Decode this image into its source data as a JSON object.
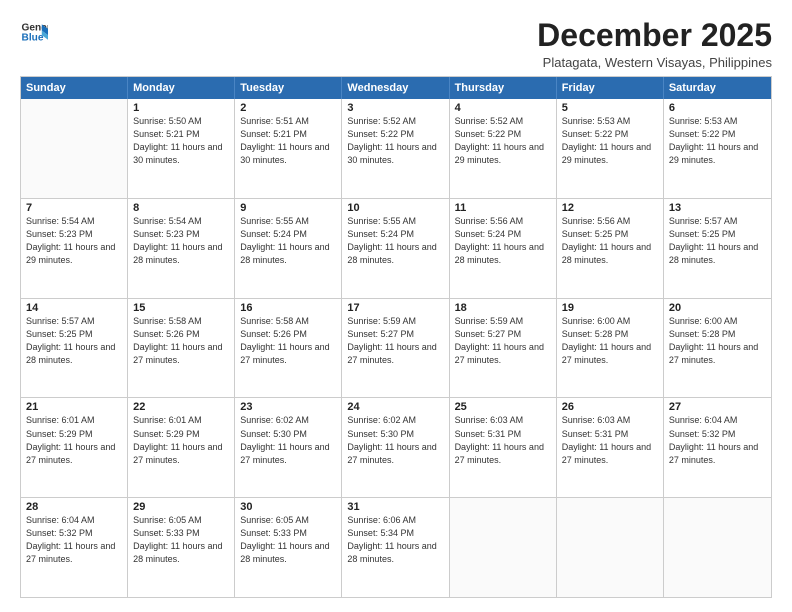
{
  "logo": {
    "line1": "General",
    "line2": "Blue"
  },
  "title": "December 2025",
  "subtitle": "Platagata, Western Visayas, Philippines",
  "header_days": [
    "Sunday",
    "Monday",
    "Tuesday",
    "Wednesday",
    "Thursday",
    "Friday",
    "Saturday"
  ],
  "weeks": [
    [
      {
        "day": "",
        "sunrise": "",
        "sunset": "",
        "daylight": ""
      },
      {
        "day": "1",
        "sunrise": "Sunrise: 5:50 AM",
        "sunset": "Sunset: 5:21 PM",
        "daylight": "Daylight: 11 hours and 30 minutes."
      },
      {
        "day": "2",
        "sunrise": "Sunrise: 5:51 AM",
        "sunset": "Sunset: 5:21 PM",
        "daylight": "Daylight: 11 hours and 30 minutes."
      },
      {
        "day": "3",
        "sunrise": "Sunrise: 5:52 AM",
        "sunset": "Sunset: 5:22 PM",
        "daylight": "Daylight: 11 hours and 30 minutes."
      },
      {
        "day": "4",
        "sunrise": "Sunrise: 5:52 AM",
        "sunset": "Sunset: 5:22 PM",
        "daylight": "Daylight: 11 hours and 29 minutes."
      },
      {
        "day": "5",
        "sunrise": "Sunrise: 5:53 AM",
        "sunset": "Sunset: 5:22 PM",
        "daylight": "Daylight: 11 hours and 29 minutes."
      },
      {
        "day": "6",
        "sunrise": "Sunrise: 5:53 AM",
        "sunset": "Sunset: 5:22 PM",
        "daylight": "Daylight: 11 hours and 29 minutes."
      }
    ],
    [
      {
        "day": "7",
        "sunrise": "Sunrise: 5:54 AM",
        "sunset": "Sunset: 5:23 PM",
        "daylight": "Daylight: 11 hours and 29 minutes."
      },
      {
        "day": "8",
        "sunrise": "Sunrise: 5:54 AM",
        "sunset": "Sunset: 5:23 PM",
        "daylight": "Daylight: 11 hours and 28 minutes."
      },
      {
        "day": "9",
        "sunrise": "Sunrise: 5:55 AM",
        "sunset": "Sunset: 5:24 PM",
        "daylight": "Daylight: 11 hours and 28 minutes."
      },
      {
        "day": "10",
        "sunrise": "Sunrise: 5:55 AM",
        "sunset": "Sunset: 5:24 PM",
        "daylight": "Daylight: 11 hours and 28 minutes."
      },
      {
        "day": "11",
        "sunrise": "Sunrise: 5:56 AM",
        "sunset": "Sunset: 5:24 PM",
        "daylight": "Daylight: 11 hours and 28 minutes."
      },
      {
        "day": "12",
        "sunrise": "Sunrise: 5:56 AM",
        "sunset": "Sunset: 5:25 PM",
        "daylight": "Daylight: 11 hours and 28 minutes."
      },
      {
        "day": "13",
        "sunrise": "Sunrise: 5:57 AM",
        "sunset": "Sunset: 5:25 PM",
        "daylight": "Daylight: 11 hours and 28 minutes."
      }
    ],
    [
      {
        "day": "14",
        "sunrise": "Sunrise: 5:57 AM",
        "sunset": "Sunset: 5:25 PM",
        "daylight": "Daylight: 11 hours and 28 minutes."
      },
      {
        "day": "15",
        "sunrise": "Sunrise: 5:58 AM",
        "sunset": "Sunset: 5:26 PM",
        "daylight": "Daylight: 11 hours and 27 minutes."
      },
      {
        "day": "16",
        "sunrise": "Sunrise: 5:58 AM",
        "sunset": "Sunset: 5:26 PM",
        "daylight": "Daylight: 11 hours and 27 minutes."
      },
      {
        "day": "17",
        "sunrise": "Sunrise: 5:59 AM",
        "sunset": "Sunset: 5:27 PM",
        "daylight": "Daylight: 11 hours and 27 minutes."
      },
      {
        "day": "18",
        "sunrise": "Sunrise: 5:59 AM",
        "sunset": "Sunset: 5:27 PM",
        "daylight": "Daylight: 11 hours and 27 minutes."
      },
      {
        "day": "19",
        "sunrise": "Sunrise: 6:00 AM",
        "sunset": "Sunset: 5:28 PM",
        "daylight": "Daylight: 11 hours and 27 minutes."
      },
      {
        "day": "20",
        "sunrise": "Sunrise: 6:00 AM",
        "sunset": "Sunset: 5:28 PM",
        "daylight": "Daylight: 11 hours and 27 minutes."
      }
    ],
    [
      {
        "day": "21",
        "sunrise": "Sunrise: 6:01 AM",
        "sunset": "Sunset: 5:29 PM",
        "daylight": "Daylight: 11 hours and 27 minutes."
      },
      {
        "day": "22",
        "sunrise": "Sunrise: 6:01 AM",
        "sunset": "Sunset: 5:29 PM",
        "daylight": "Daylight: 11 hours and 27 minutes."
      },
      {
        "day": "23",
        "sunrise": "Sunrise: 6:02 AM",
        "sunset": "Sunset: 5:30 PM",
        "daylight": "Daylight: 11 hours and 27 minutes."
      },
      {
        "day": "24",
        "sunrise": "Sunrise: 6:02 AM",
        "sunset": "Sunset: 5:30 PM",
        "daylight": "Daylight: 11 hours and 27 minutes."
      },
      {
        "day": "25",
        "sunrise": "Sunrise: 6:03 AM",
        "sunset": "Sunset: 5:31 PM",
        "daylight": "Daylight: 11 hours and 27 minutes."
      },
      {
        "day": "26",
        "sunrise": "Sunrise: 6:03 AM",
        "sunset": "Sunset: 5:31 PM",
        "daylight": "Daylight: 11 hours and 27 minutes."
      },
      {
        "day": "27",
        "sunrise": "Sunrise: 6:04 AM",
        "sunset": "Sunset: 5:32 PM",
        "daylight": "Daylight: 11 hours and 27 minutes."
      }
    ],
    [
      {
        "day": "28",
        "sunrise": "Sunrise: 6:04 AM",
        "sunset": "Sunset: 5:32 PM",
        "daylight": "Daylight: 11 hours and 27 minutes."
      },
      {
        "day": "29",
        "sunrise": "Sunrise: 6:05 AM",
        "sunset": "Sunset: 5:33 PM",
        "daylight": "Daylight: 11 hours and 28 minutes."
      },
      {
        "day": "30",
        "sunrise": "Sunrise: 6:05 AM",
        "sunset": "Sunset: 5:33 PM",
        "daylight": "Daylight: 11 hours and 28 minutes."
      },
      {
        "day": "31",
        "sunrise": "Sunrise: 6:06 AM",
        "sunset": "Sunset: 5:34 PM",
        "daylight": "Daylight: 11 hours and 28 minutes."
      },
      {
        "day": "",
        "sunrise": "",
        "sunset": "",
        "daylight": ""
      },
      {
        "day": "",
        "sunrise": "",
        "sunset": "",
        "daylight": ""
      },
      {
        "day": "",
        "sunrise": "",
        "sunset": "",
        "daylight": ""
      }
    ]
  ]
}
